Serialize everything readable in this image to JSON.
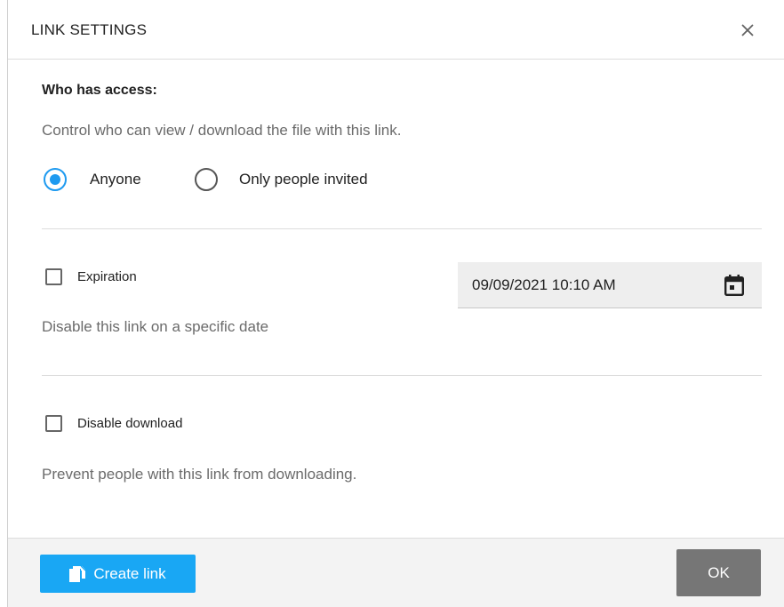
{
  "dialog": {
    "title": "LINK SETTINGS",
    "close_icon": "close-icon"
  },
  "access": {
    "heading": "Who has access:",
    "description": "Control who can view / download the file with this link.",
    "options": [
      {
        "label": "Anyone",
        "selected": true
      },
      {
        "label": "Only people invited",
        "selected": false
      }
    ]
  },
  "expiration": {
    "label": "Expiration",
    "checked": false,
    "description": "Disable this link on a specific date",
    "date_value": "09/09/2021 10:10 AM",
    "calendar_icon": "calendar-icon"
  },
  "download": {
    "label": "Disable download",
    "checked": false,
    "description": "Prevent people with this link from downloading."
  },
  "footer": {
    "create_link_label": "Create link",
    "create_link_icon": "copy-icon",
    "ok_label": "OK"
  },
  "colors": {
    "accent": "#1e9af0",
    "create_button": "#19a7f4",
    "ok_button": "#767676"
  }
}
